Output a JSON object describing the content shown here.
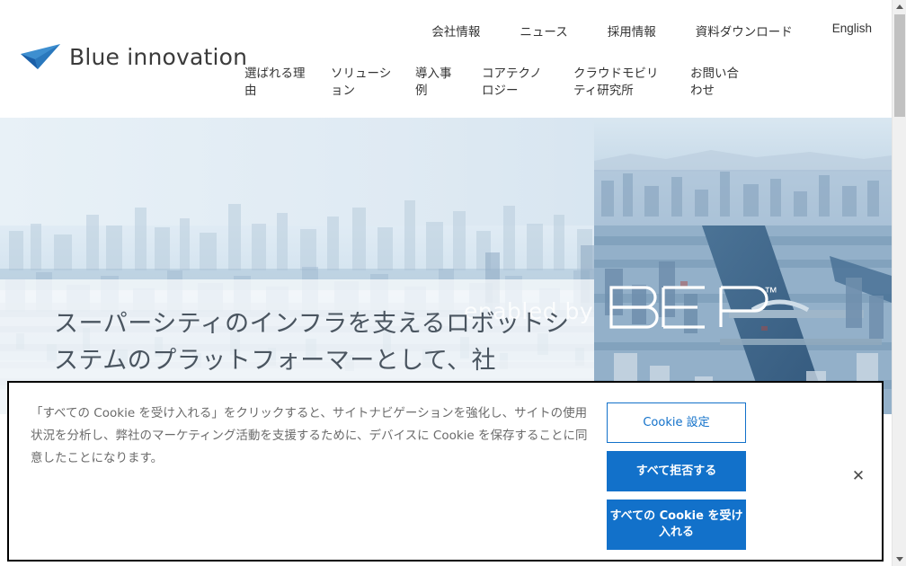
{
  "brand": {
    "name": "Blue innovation",
    "logo_icon": "paper-plane-logo",
    "logo_color_light": "#3e8fd0",
    "logo_color_dark": "#1b5fa8"
  },
  "header": {
    "utility_nav": [
      {
        "label": "会社情報"
      },
      {
        "label": "ニュース"
      },
      {
        "label": "採用情報"
      },
      {
        "label": "資料ダウンロード"
      },
      {
        "label": "English"
      }
    ],
    "main_nav": [
      {
        "label": "選ばれる理由"
      },
      {
        "label": "ソリューション"
      },
      {
        "label": "導入事例"
      },
      {
        "label": "コアテクノロジー"
      },
      {
        "label": "クラウドモビリティ研究所"
      },
      {
        "label": "お問い合わせ"
      }
    ]
  },
  "hero": {
    "headline": "スーパーシティのインフラを支えるロボットシステムのプラットフォーマーとして、社",
    "bep_prefix": "enabled by",
    "bep_wordmark": "BEP",
    "bep_trademark": "™",
    "image_alt": "aerial-cityscape-photo"
  },
  "cookie_banner": {
    "message": "「すべての Cookie を受け入れる」をクリックすると、サイトナビゲーションを強化し、サイトの使用状況を分析し、弊社のマーケティング活動を支援するために、デバイスに Cookie を保存することに同意したことになります。",
    "settings_label": "Cookie 設定",
    "reject_label": "すべて拒否する",
    "accept_label": "すべての Cookie を受け入れる",
    "close_icon": "✕",
    "accent_color": "#1271ca"
  },
  "scrollbar": {
    "up_icon": "triangle-up-icon",
    "down_icon": "triangle-down-icon",
    "thumb": "scrollbar-thumb"
  }
}
